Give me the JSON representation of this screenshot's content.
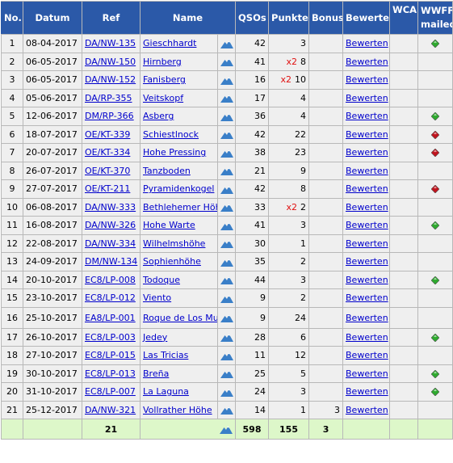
{
  "headers": {
    "no": "No.",
    "datum": "Datum",
    "ref": "Ref",
    "name": "Name",
    "qsos": "QSOs",
    "punkte": "Punkte",
    "bonus": "Bonus",
    "bewerte": "Bewerte",
    "wca": "WCA",
    "wwff": "WWFF",
    "mailed": "mailed"
  },
  "icons": {
    "mountain": "mountain-icon",
    "green_flag": "green-diamond-icon",
    "red_flag": "red-diamond-icon"
  },
  "colors": {
    "header_bg": "#2b59a8",
    "row_bg": "#efefef",
    "footer_bg": "#ddf7c9",
    "link": "#0000cc",
    "multiplier": "#e01010",
    "diamond_green": "#2eaa2e",
    "diamond_red": "#c0141e"
  },
  "rows": [
    {
      "no": "1",
      "datum": "08-04-2017",
      "ref": "DA/NW-135",
      "name": "Gieschhardt",
      "qsos": "42",
      "mult": "",
      "punkte": "3",
      "bonus": "",
      "bewerten": "Bewerten",
      "wwff": "green"
    },
    {
      "no": "2",
      "datum": "06-05-2017",
      "ref": "DA/NW-150",
      "name": "Hirnberg",
      "qsos": "41",
      "mult": "x2",
      "punkte": "8",
      "bonus": "",
      "bewerten": "Bewerten",
      "wwff": ""
    },
    {
      "no": "3",
      "datum": "06-05-2017",
      "ref": "DA/NW-152",
      "name": "Fanisberg",
      "qsos": "16",
      "mult": "x2",
      "punkte": "10",
      "bonus": "",
      "bewerten": "Bewerten",
      "wwff": ""
    },
    {
      "no": "4",
      "datum": "05-06-2017",
      "ref": "DA/RP-355",
      "name": "Veitskopf",
      "qsos": "17",
      "mult": "",
      "punkte": "4",
      "bonus": "",
      "bewerten": "Bewerten",
      "wwff": ""
    },
    {
      "no": "5",
      "datum": "12-06-2017",
      "ref": "DM/RP-366",
      "name": "Asberg",
      "qsos": "36",
      "mult": "",
      "punkte": "4",
      "bonus": "",
      "bewerten": "Bewerten",
      "wwff": "green"
    },
    {
      "no": "6",
      "datum": "18-07-2017",
      "ref": "OE/KT-339",
      "name": "Schiestlnock",
      "qsos": "42",
      "mult": "",
      "punkte": "22",
      "bonus": "",
      "bewerten": "Bewerten",
      "wwff": "red"
    },
    {
      "no": "7",
      "datum": "20-07-2017",
      "ref": "OE/KT-334",
      "name": "Hohe Pressing",
      "qsos": "38",
      "mult": "",
      "punkte": "23",
      "bonus": "",
      "bewerten": "Bewerten",
      "wwff": "red"
    },
    {
      "no": "8",
      "datum": "26-07-2017",
      "ref": "OE/KT-370",
      "name": "Tanzboden",
      "qsos": "21",
      "mult": "",
      "punkte": "9",
      "bonus": "",
      "bewerten": "Bewerten",
      "wwff": ""
    },
    {
      "no": "9",
      "datum": "27-07-2017",
      "ref": "OE/KT-211",
      "name": "Pyramidenkogel",
      "qsos": "42",
      "mult": "",
      "punkte": "8",
      "bonus": "",
      "bewerten": "Bewerten",
      "wwff": "red"
    },
    {
      "no": "10",
      "datum": "06-08-2017",
      "ref": "DA/NW-333",
      "name": "Bethlehemer Höhe",
      "qsos": "33",
      "mult": "x2",
      "punkte": "2",
      "bonus": "",
      "bewerten": "Bewerten",
      "wwff": ""
    },
    {
      "no": "11",
      "datum": "16-08-2017",
      "ref": "DA/NW-326",
      "name": "Hohe Warte",
      "qsos": "41",
      "mult": "",
      "punkte": "3",
      "bonus": "",
      "bewerten": "Bewerten",
      "wwff": "green"
    },
    {
      "no": "12",
      "datum": "22-08-2017",
      "ref": "DA/NW-334",
      "name": "Wilhelmshöhe",
      "qsos": "30",
      "mult": "",
      "punkte": "1",
      "bonus": "",
      "bewerten": "Bewerten",
      "wwff": ""
    },
    {
      "no": "13",
      "datum": "24-09-2017",
      "ref": "DM/NW-134",
      "name": "Sophienhöhe",
      "qsos": "35",
      "mult": "",
      "punkte": "2",
      "bonus": "",
      "bewerten": "Bewerten",
      "wwff": ""
    },
    {
      "no": "14",
      "datum": "20-10-2017",
      "ref": "EC8/LP-008",
      "name": "Todoque",
      "qsos": "44",
      "mult": "",
      "punkte": "3",
      "bonus": "",
      "bewerten": "Bewerten",
      "wwff": "green"
    },
    {
      "no": "15",
      "datum": "23-10-2017",
      "ref": "EC8/LP-012",
      "name": "Viento",
      "qsos": "9",
      "mult": "",
      "punkte": "2",
      "bonus": "",
      "bewerten": "Bewerten",
      "wwff": ""
    },
    {
      "no": "16",
      "datum": "25-10-2017",
      "ref": "EA8/LP-001",
      "name": "Roque de Los Muchachos",
      "qsos": "9",
      "mult": "",
      "punkte": "24",
      "bonus": "",
      "bewerten": "Bewerten",
      "wwff": ""
    },
    {
      "no": "17",
      "datum": "26-10-2017",
      "ref": "EC8/LP-003",
      "name": "Jedey",
      "qsos": "28",
      "mult": "",
      "punkte": "6",
      "bonus": "",
      "bewerten": "Bewerten",
      "wwff": "green"
    },
    {
      "no": "18",
      "datum": "27-10-2017",
      "ref": "EC8/LP-015",
      "name": "Las Tricias",
      "qsos": "11",
      "mult": "",
      "punkte": "12",
      "bonus": "",
      "bewerten": "Bewerten",
      "wwff": ""
    },
    {
      "no": "19",
      "datum": "30-10-2017",
      "ref": "EC8/LP-013",
      "name": "Breña",
      "qsos": "25",
      "mult": "",
      "punkte": "5",
      "bonus": "",
      "bewerten": "Bewerten",
      "wwff": "green"
    },
    {
      "no": "20",
      "datum": "31-10-2017",
      "ref": "EC8/LP-007",
      "name": "La Laguna",
      "qsos": "24",
      "mult": "",
      "punkte": "3",
      "bonus": "",
      "bewerten": "Bewerten",
      "wwff": "green"
    },
    {
      "no": "21",
      "datum": "25-12-2017",
      "ref": "DA/NW-321",
      "name": "Vollrather Höhe",
      "qsos": "14",
      "mult": "",
      "punkte": "1",
      "bonus": "3",
      "bewerten": "Bewerten",
      "wwff": ""
    }
  ],
  "totals": {
    "count": "21",
    "qsos": "598",
    "punkte": "155",
    "bonus": "3"
  }
}
